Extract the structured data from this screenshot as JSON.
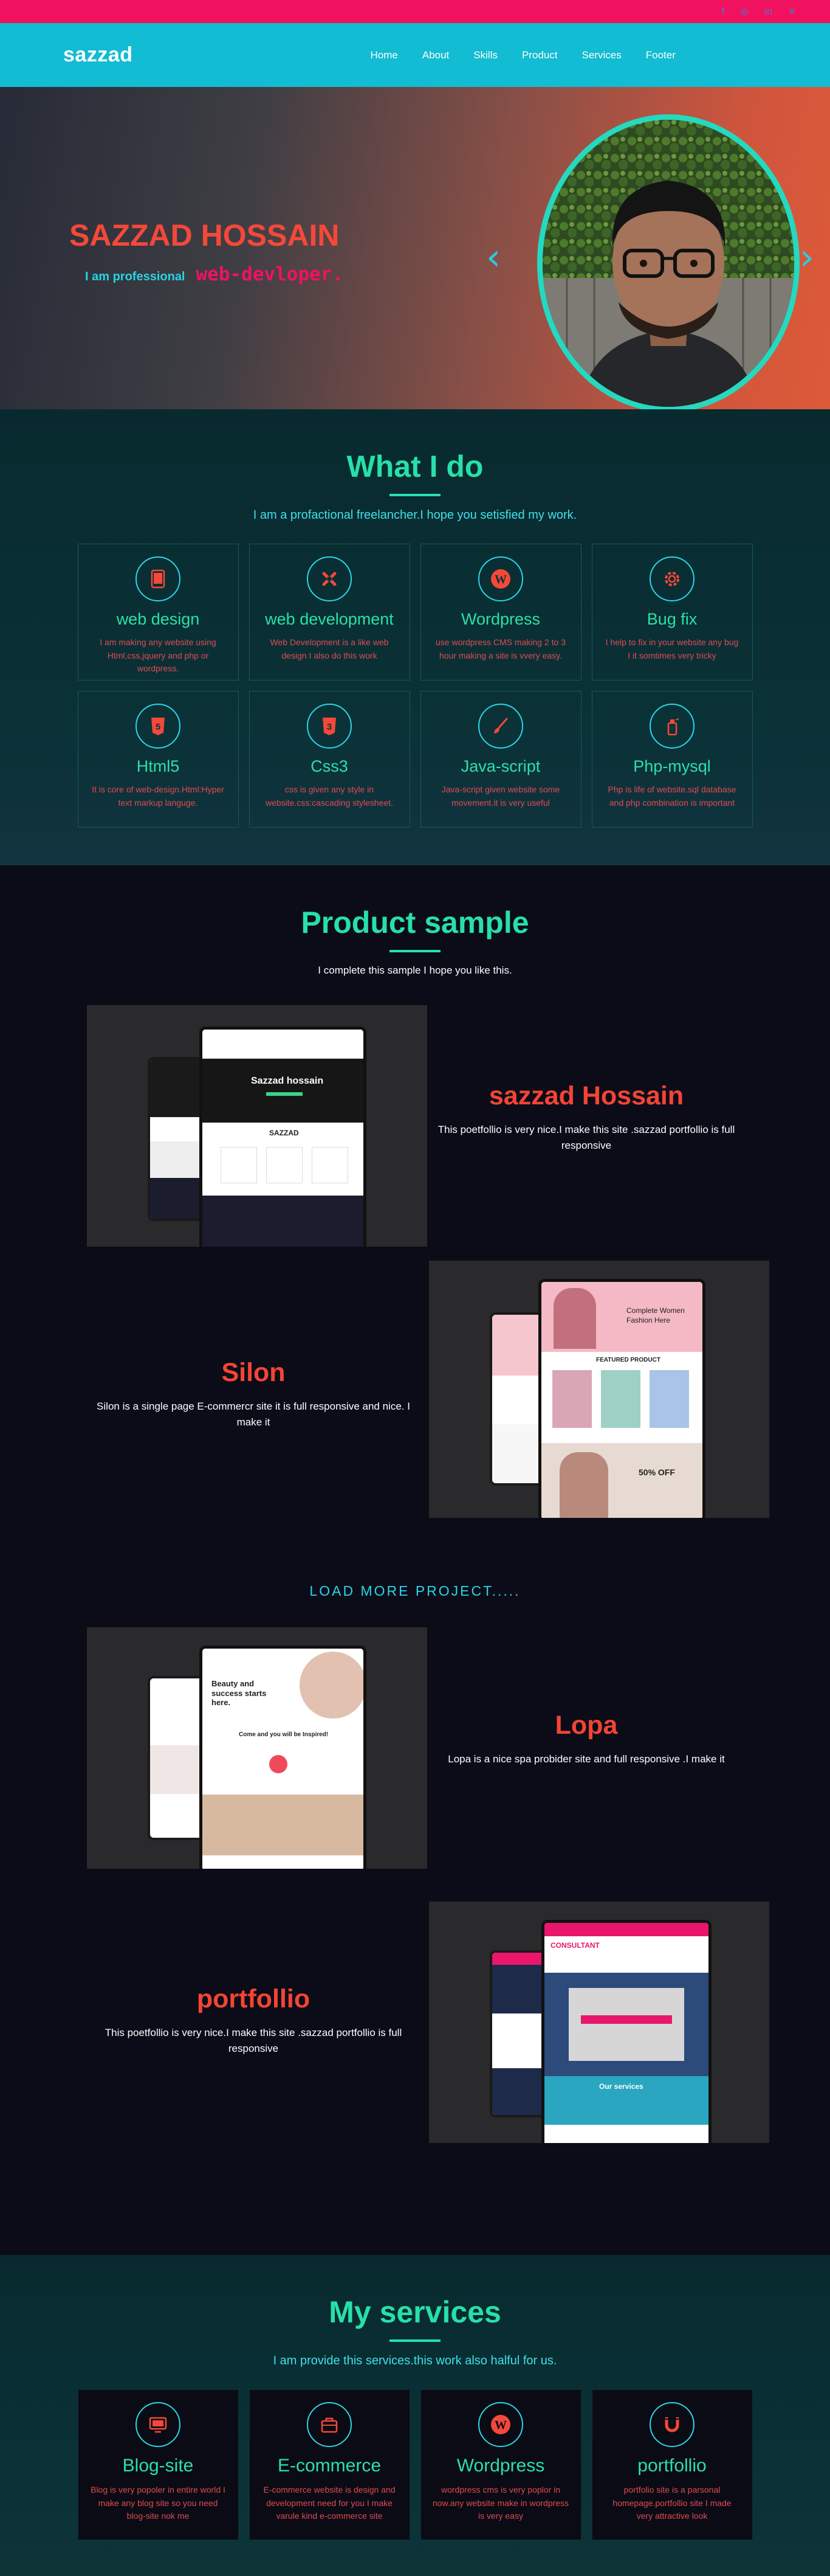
{
  "social": [
    {
      "name": "facebook-icon",
      "glyph": "f"
    },
    {
      "name": "instagram-icon",
      "glyph": "◎"
    },
    {
      "name": "linkedin-icon",
      "glyph": "in"
    },
    {
      "name": "twitter-icon",
      "glyph": "𝕏"
    }
  ],
  "nav": {
    "logo": "sazzad",
    "items": [
      "Home",
      "About",
      "Skills",
      "Product",
      "Services",
      "Footer"
    ]
  },
  "hero": {
    "name": "SAZZAD HOSSAIN",
    "prefix": "I am professional",
    "typed": "web-devloper."
  },
  "whatido": {
    "title": "What I do",
    "subtitle": "I am a profactional freelancher.I hope you setisfied my work.",
    "cards": [
      {
        "icon": "tablet-icon",
        "title": "web design",
        "desc": "I am making any website using Html,css,jquery and php or wordpress."
      },
      {
        "icon": "joomla-icon",
        "title": "web development",
        "desc": "Web Development is a like web design I also do this work"
      },
      {
        "icon": "wordpress-icon",
        "title": "Wordpress",
        "desc": "use wordpress CMS making 2 to 3 hour making a site is vvery easy."
      },
      {
        "icon": "gear-icon",
        "title": "Bug fix",
        "desc": "I help to fix in your website any bug I it somtimes very tricky"
      },
      {
        "icon": "html5-icon",
        "title": "Html5",
        "desc": "It is core of web-design.Html:Hyper text markup languge."
      },
      {
        "icon": "css3-icon",
        "title": "Css3",
        "desc": "css is given any style in website.css:cascading stylesheet."
      },
      {
        "icon": "brush-icon",
        "title": "Java-script",
        "desc": "Java-script given website some movement.it is very useful"
      },
      {
        "icon": "spray-icon",
        "title": "Php-mysql",
        "desc": "Php is life of website.sql database and php combination is important"
      }
    ]
  },
  "product": {
    "title": "Product sample",
    "subtitle": "I complete this sample I hope you like this.",
    "projects": [
      {
        "title": "sazzad Hossain",
        "desc": "This poetfollio is very nice.I make this site .sazzad portfollio is full responsive",
        "screen_title": "Sazzad hossain",
        "screen_brand": "SAZZAD"
      },
      {
        "title": "Silon",
        "desc": "Silon is a single page E-commercr site it is full responsive and nice. I make it",
        "screen_title": "Complete Women Fashion Here",
        "screen_section": "FEATURED PRODUCT",
        "screen_sale": "50% OFF"
      },
      {
        "title": "Lopa",
        "desc": "Lopa is a nice spa probider site and full responsive .I make it",
        "screen_title": "Beauty and success starts here.",
        "screen_section": "Come and you will be Inspired!"
      },
      {
        "title": "portfollio",
        "desc": "This poetfollio is very nice.I make this site .sazzad portfollio is full responsive",
        "screen_title": "CONSULTANT",
        "screen_section": "Our services"
      }
    ],
    "load_more": "LOAD MORE PROJECT....."
  },
  "services": {
    "title": "My services",
    "subtitle": "I am provide this services.this work also halful for us.",
    "cards": [
      {
        "icon": "monitor-icon",
        "title": "Blog-site",
        "desc": "Blog is very popoler in entire world I make any blog site so you need blog-site nok me"
      },
      {
        "icon": "briefcase-icon",
        "title": "E-commerce",
        "desc": "E-commerce website is design and development need for you I make varule kind e-commerce site"
      },
      {
        "icon": "wordpress-icon",
        "title": "Wordpress",
        "desc": "wordpress cms is very poplor in now.any website make in wordpress is very easy"
      },
      {
        "icon": "magnet-icon",
        "title": "portfollio",
        "desc": "portfolio site is a parsonal homepage.portfollio site I made very attractive look"
      }
    ]
  },
  "colors": {
    "accent_pink": "#f0125f",
    "accent_cyan": "#12bcd2",
    "accent_green": "#27e0a8",
    "accent_red": "#f44434"
  }
}
